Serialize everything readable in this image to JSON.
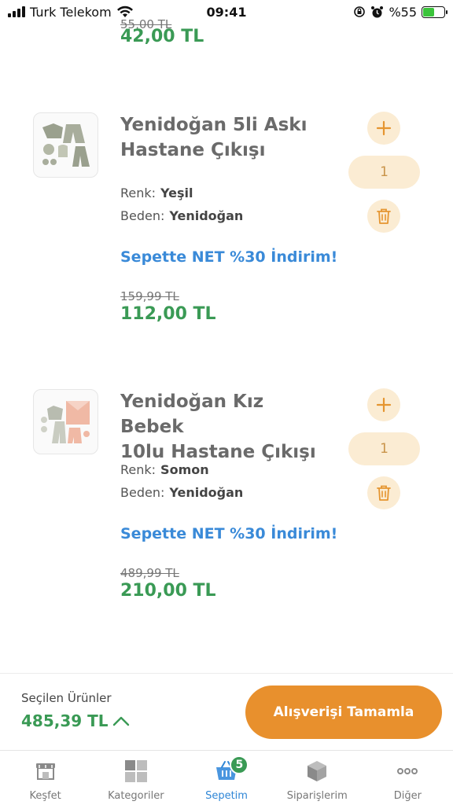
{
  "status_bar": {
    "carrier": "Turk Telekom",
    "time": "09:41",
    "battery_percent": "%55",
    "battery_level": 0.55
  },
  "cart": {
    "prev_item": {
      "old_price": "55,00 TL",
      "price": "42,00 TL"
    },
    "items": [
      {
        "title_line1": "Yenidoğan 5li Askı",
        "title_line2": "Hastane Çıkışı",
        "color_label": "Renk:",
        "color": "Yeşil",
        "size_label": "Beden:",
        "size": "Yenidoğan",
        "promo": "Sepette NET %30 İndirim!",
        "old_price": "159,99 TL",
        "price": "112,00 TL",
        "quantity": "1",
        "plus_icon": "plus-icon",
        "delete_icon": "trash-icon"
      },
      {
        "title_line1": "Yenidoğan Kız Bebek",
        "title_line2": "10lu Hastane Çıkışı",
        "color_label": "Renk:",
        "color": "Somon",
        "size_label": "Beden:",
        "size": "Yenidoğan",
        "promo": "Sepette NET %30 İndirim!",
        "old_price": "489,99 TL",
        "price": "210,00 TL",
        "quantity": "1",
        "plus_icon": "plus-icon",
        "delete_icon": "trash-icon"
      }
    ]
  },
  "summary": {
    "label": "Seçilen Ürünler",
    "total": "485,39 TL",
    "checkout_label": "Alışverişi Tamamla"
  },
  "tabbar": {
    "tabs": [
      {
        "label": "Keşfet",
        "icon": "store-icon"
      },
      {
        "label": "Kategoriler",
        "icon": "grid-icon"
      },
      {
        "label": "Sepetim",
        "icon": "basket-icon",
        "badge": "5",
        "active": true
      },
      {
        "label": "Siparişlerim",
        "icon": "box-icon"
      },
      {
        "label": "Diğer",
        "icon": "more-icon"
      }
    ]
  },
  "colors": {
    "accent_orange": "#e8902d",
    "light_orange": "#fbecd3",
    "price_green": "#3a9a55",
    "promo_blue": "#3a8ad8",
    "active_tab_blue": "#2f86d6"
  }
}
